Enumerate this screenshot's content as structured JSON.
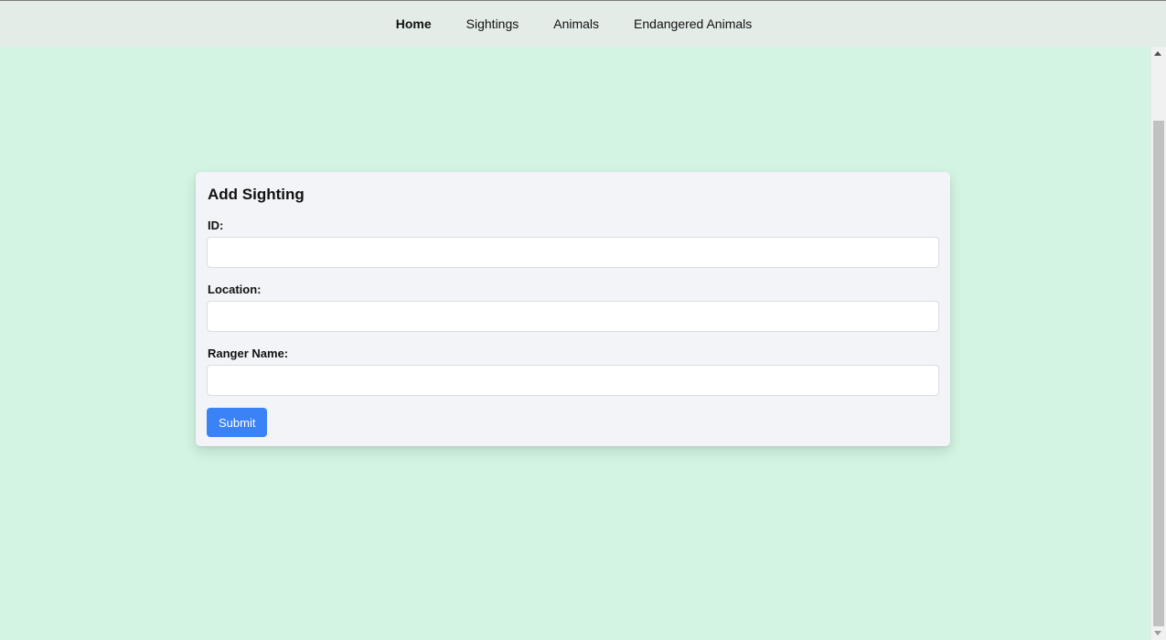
{
  "nav": {
    "items": [
      {
        "label": "Home",
        "active": true
      },
      {
        "label": "Sightings",
        "active": false
      },
      {
        "label": "Animals",
        "active": false
      },
      {
        "label": "Endangered Animals",
        "active": false
      }
    ]
  },
  "form": {
    "title": "Add Sighting",
    "fields": [
      {
        "label": "ID:",
        "value": "",
        "placeholder": ""
      },
      {
        "label": "Location:",
        "value": "",
        "placeholder": ""
      },
      {
        "label": "Ranger Name:",
        "value": "",
        "placeholder": ""
      }
    ],
    "submit_label": "Submit"
  },
  "colors": {
    "page_background": "#d3f4e2",
    "nav_background": "#e4ece8",
    "card_background": "#f3f4f7",
    "submit_button": "#3b82f6"
  }
}
